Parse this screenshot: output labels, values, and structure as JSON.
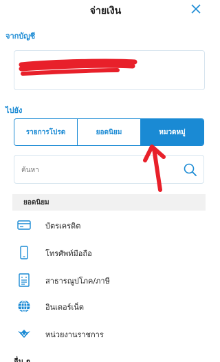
{
  "header": {
    "title": "จ่ายเงิน"
  },
  "from_account": {
    "label": "จากบัญชี",
    "value": ""
  },
  "to": {
    "label": "ไปยัง"
  },
  "tabs": [
    {
      "label": "รายการโปรด",
      "active": false
    },
    {
      "label": "ยอดนิยม",
      "active": false
    },
    {
      "label": "หมวดหมู่",
      "active": true
    }
  ],
  "search": {
    "placeholder": "ค้นหา"
  },
  "popular": {
    "label": "ยอดนิยม",
    "items": [
      {
        "label": "บัตรเครดิต",
        "icon": "credit-card-icon"
      },
      {
        "label": "โทรศัพท์มือถือ",
        "icon": "mobile-phone-icon"
      },
      {
        "label": "สาธารณูปโภค/ภาษี",
        "icon": "utility-bill-icon"
      },
      {
        "label": "อินเตอร์เน็ต",
        "icon": "globe-icon"
      },
      {
        "label": "หน่วยงานราชการ",
        "icon": "government-emblem-icon"
      }
    ]
  },
  "more": {
    "label": "อื่น ๆ"
  },
  "colors": {
    "accent": "#1a8ad4",
    "annotation": "#e8202a"
  }
}
